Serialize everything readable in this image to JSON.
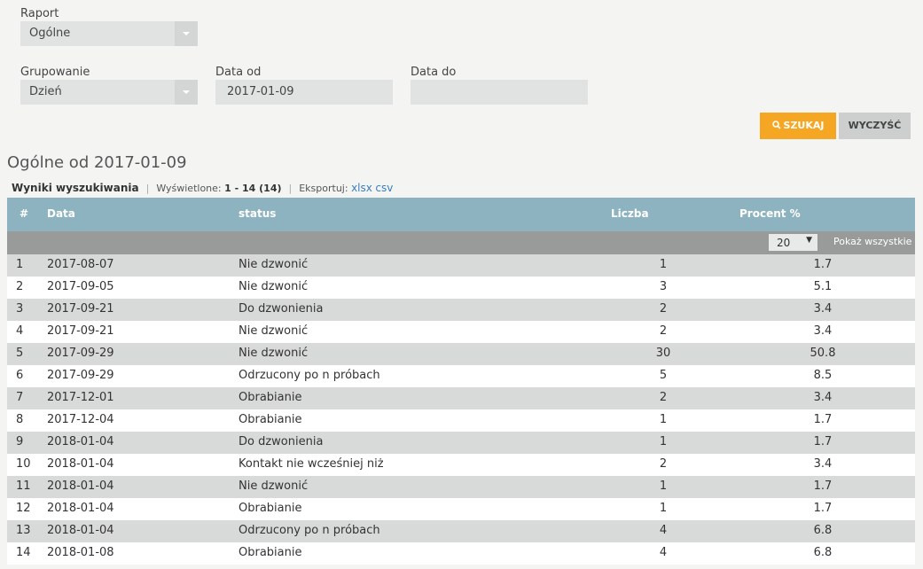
{
  "form": {
    "report_label": "Raport",
    "report_value": "Ogólne",
    "grouping_label": "Grupowanie",
    "grouping_value": "Dzień",
    "date_from_label": "Data od",
    "date_from_value": "2017-01-09",
    "date_to_label": "Data do",
    "date_to_value": "",
    "search_label": "SZUKAJ",
    "search_icon": "search-icon",
    "clear_label": "WYCZYŚĆ"
  },
  "results": {
    "title": "Ogólne od 2017-01-09",
    "heading": "Wyniki wyszukiwania",
    "shown_label": "Wyświetlone:",
    "shown_value": "1 - 14 (14)",
    "export_label": "Eksportuj:",
    "export_xlsx": "xlsx",
    "export_csv": "csv",
    "per_page": "20",
    "show_all": "Pokaż wszystkie",
    "columns": [
      "#",
      "Data",
      "status",
      "Liczba",
      "Procent %"
    ],
    "rows": [
      [
        "1",
        "2017-08-07",
        "Nie dzwonić",
        "1",
        "1.7"
      ],
      [
        "2",
        "2017-09-05",
        "Nie dzwonić",
        "3",
        "5.1"
      ],
      [
        "3",
        "2017-09-21",
        "Do dzwonienia",
        "2",
        "3.4"
      ],
      [
        "4",
        "2017-09-21",
        "Nie dzwonić",
        "2",
        "3.4"
      ],
      [
        "5",
        "2017-09-29",
        "Nie dzwonić",
        "30",
        "50.8"
      ],
      [
        "6",
        "2017-09-29",
        "Odrzucony po n próbach",
        "5",
        "8.5"
      ],
      [
        "7",
        "2017-12-01",
        "Obrabianie",
        "2",
        "3.4"
      ],
      [
        "8",
        "2017-12-04",
        "Obrabianie",
        "1",
        "1.7"
      ],
      [
        "9",
        "2018-01-04",
        "Do dzwonienia",
        "1",
        "1.7"
      ],
      [
        "10",
        "2018-01-04",
        "Kontakt nie wcześniej niż",
        "2",
        "3.4"
      ],
      [
        "11",
        "2018-01-04",
        "Nie dzwonić",
        "1",
        "1.7"
      ],
      [
        "12",
        "2018-01-04",
        "Obrabianie",
        "1",
        "1.7"
      ],
      [
        "13",
        "2018-01-04",
        "Odrzucony po n próbach",
        "4",
        "6.8"
      ],
      [
        "14",
        "2018-01-08",
        "Obrabianie",
        "4",
        "6.8"
      ]
    ]
  },
  "colors": {
    "accent": "#f5a623",
    "table_header": "#8db3c0",
    "link": "#3a7ebf"
  }
}
